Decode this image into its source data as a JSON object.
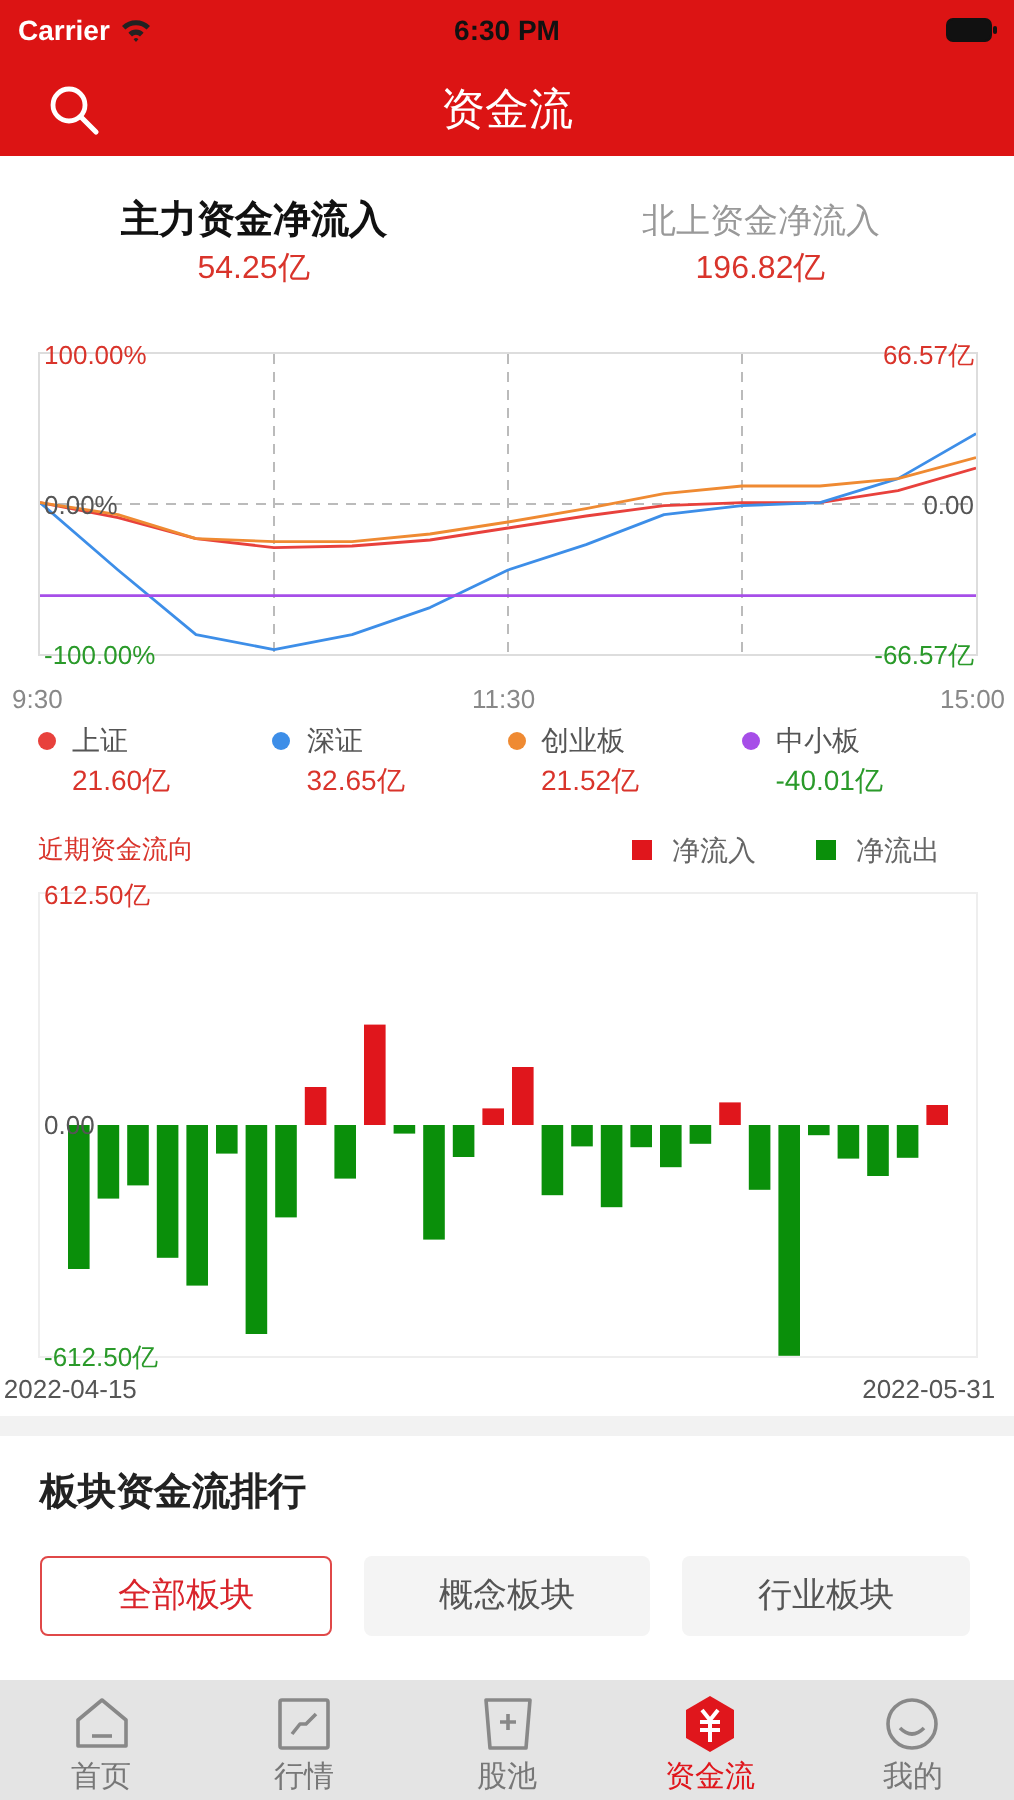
{
  "status_bar": {
    "carrier": "Carrier",
    "time": "6:30 PM"
  },
  "nav": {
    "title": "资金流"
  },
  "summary": [
    {
      "label": "主力资金净流入",
      "value": "54.25亿",
      "selected": true
    },
    {
      "label": "北上资金净流入",
      "value": "196.82亿",
      "selected": false
    }
  ],
  "intraday": {
    "chart_data": {
      "type": "line",
      "grid": true,
      "legend": "bottom",
      "categories": [
        "9:30",
        null,
        null,
        null,
        null,
        null,
        "11:30",
        null,
        null,
        null,
        null,
        null,
        "15:00"
      ],
      "ylim": [
        -100,
        100
      ],
      "yticks": [
        {
          "value": 100,
          "label": "100.00%"
        },
        {
          "value": 0,
          "label": "0.00%"
        },
        {
          "value": -100,
          "label": "-100.00%"
        }
      ],
      "series": [
        {
          "name": "上证",
          "color": "#e8413c",
          "values": [
            1,
            -9,
            -23,
            -29,
            -28,
            -24,
            -16,
            -8,
            -1,
            1,
            1,
            9,
            24
          ]
        },
        {
          "name": "深证",
          "color": "#3d8ee8",
          "values": [
            1,
            -44,
            -87,
            -97,
            -87,
            -69,
            -44,
            -27,
            -7,
            -1,
            1,
            17,
            47
          ]
        },
        {
          "name": "创业板",
          "color": "#ef8a32",
          "values": [
            1,
            -7,
            -23,
            -25,
            -25,
            -20,
            -12,
            -3,
            7,
            12,
            12,
            17,
            31
          ]
        },
        {
          "name": "中小板",
          "color": "#a64ee8",
          "values": [
            -61,
            -61,
            -61,
            -61,
            -61,
            -61,
            -61,
            -61,
            -61,
            -61,
            -61,
            -61,
            -61
          ]
        }
      ]
    },
    "right_ticks": [
      "66.57亿",
      "0.00",
      "-66.57亿"
    ],
    "legend_values": [
      "21.60亿",
      "32.65亿",
      "21.52亿",
      "-40.01亿"
    ]
  },
  "recent": {
    "title": "近期资金流向",
    "chart_data": {
      "type": "bar",
      "stacked": true,
      "legend": "top-right",
      "categories": [
        "2022-04-15",
        null,
        null,
        null,
        null,
        null,
        null,
        null,
        null,
        null,
        null,
        null,
        null,
        null,
        null,
        null,
        null,
        null,
        null,
        null,
        null,
        null,
        null,
        null,
        null,
        null,
        null,
        null,
        null,
        "2022-05-31"
      ],
      "series": [
        {
          "name": "净流入",
          "color": "#e0161c",
          "values": [
            null,
            null,
            null,
            null,
            null,
            null,
            null,
            null,
            101,
            null,
            266,
            null,
            null,
            null,
            44,
            154,
            null,
            null,
            null,
            null,
            null,
            null,
            60,
            null,
            null,
            null,
            null,
            null,
            null,
            53
          ]
        },
        {
          "name": "净流出",
          "color": "#0a8f0a",
          "values": [
            -382,
            -195,
            -160,
            -352,
            -426,
            -76,
            -554,
            -245,
            null,
            -142,
            null,
            -23,
            -304,
            -85,
            null,
            null,
            -186,
            -57,
            -218,
            -59,
            -112,
            -50,
            null,
            -172,
            -612,
            -27,
            -89,
            -135,
            -87,
            null
          ]
        }
      ],
      "ylim": [
        -612.5,
        612.5
      ],
      "yticks": [
        {
          "value": 612.5,
          "label": "612.50亿"
        },
        {
          "value": 0,
          "label": "0.00"
        },
        {
          "value": -612.5,
          "label": "-612.50亿"
        }
      ]
    }
  },
  "ranking": {
    "title": "板块资金流排行",
    "tabs": [
      {
        "label": "全部板块",
        "selected": true
      },
      {
        "label": "概念板块",
        "selected": false
      },
      {
        "label": "行业板块",
        "selected": false
      }
    ]
  },
  "tab_bar": [
    {
      "label": "首页",
      "selected": false
    },
    {
      "label": "行情",
      "selected": false
    },
    {
      "label": "股池",
      "selected": false
    },
    {
      "label": "资金流",
      "selected": true
    },
    {
      "label": "我的",
      "selected": false
    }
  ]
}
